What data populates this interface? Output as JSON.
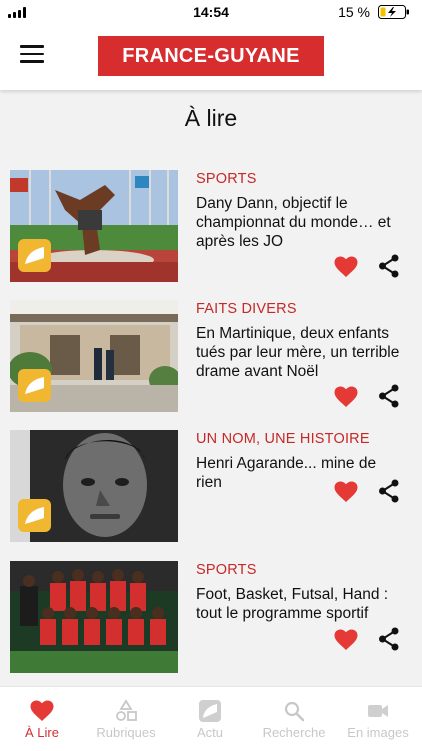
{
  "status": {
    "time": "14:54",
    "battery": "15 %"
  },
  "header": {
    "logo_text": "FRANCE-GUYANE",
    "menu_icon": "hamburger-icon"
  },
  "page": {
    "title": "À lire"
  },
  "articles": [
    {
      "category": "SPORTS",
      "title": "Dany Dann, objectif le championnat du monde… et après les JO",
      "image": "breakdancer-photo"
    },
    {
      "category": "FAITS DIVERS",
      "title": "En Martinique, deux enfants tués par leur mère, un terrible drame avant Noël",
      "image": "police-house-photo"
    },
    {
      "category": "UN NOM, UNE HISTOIRE",
      "title": "Henri Agarande... mine de rien",
      "image": "portrait-photo"
    },
    {
      "category": "SPORTS",
      "title": "Foot, Basket, Futsal, Hand : tout le programme sportif",
      "image": "football-team-photo"
    }
  ],
  "colors": {
    "brand_red": "#d72d2f",
    "category_red": "#c62828",
    "heart_red": "#e53935",
    "badge_yellow": "#f2b731"
  },
  "tabs": [
    {
      "label": "À Lire",
      "icon": "heart-icon",
      "active": true
    },
    {
      "label": "Rubriques",
      "icon": "shapes-icon",
      "active": false
    },
    {
      "label": "Actu",
      "icon": "news-icon",
      "active": false
    },
    {
      "label": "Recherche",
      "icon": "search-icon",
      "active": false
    },
    {
      "label": "En images",
      "icon": "video-camera-icon",
      "active": false
    }
  ]
}
